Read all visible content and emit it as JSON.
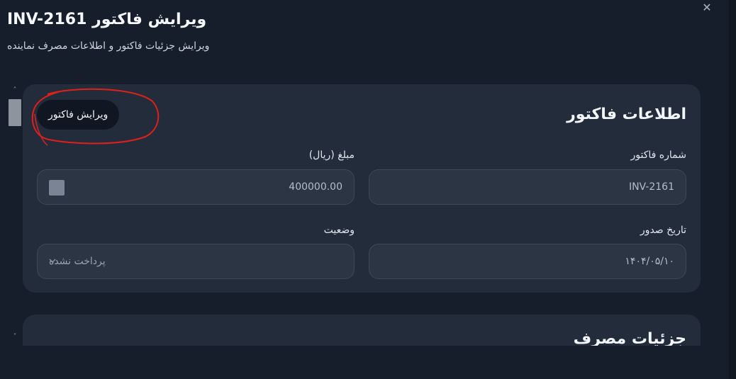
{
  "dialog": {
    "title": "ویرایش فاکتور INV-2161",
    "subtitle": "ویرایش جزئیات فاکتور و اطلاعات مصرف نماینده",
    "close_icon": "close-icon",
    "close_glyph": "✕"
  },
  "invoice_card": {
    "title": "اطلاعات فاکتور",
    "edit_button_label": "ویرایش فاکتور",
    "fields": {
      "invoice_number": {
        "label": "شماره فاکتور",
        "value": "INV-2161"
      },
      "amount": {
        "label": "مبلغ (ریال)",
        "value": "400000.00"
      },
      "issue_date": {
        "label": "تاریخ صدور",
        "value": "۱۴۰۴/۰۵/۱۰"
      },
      "status": {
        "label": "وضعیت",
        "selected": "پرداخت نشده"
      }
    }
  },
  "usage_card": {
    "title": "جزئیات مصرف"
  },
  "scrollbar": {
    "up_glyph": "˄",
    "down_glyph": "˅"
  },
  "annotation_color": "#e0201b",
  "colors": {
    "background": "#161e2b",
    "card": "#222c3b",
    "field": "#2b3544",
    "button": "#111722"
  }
}
